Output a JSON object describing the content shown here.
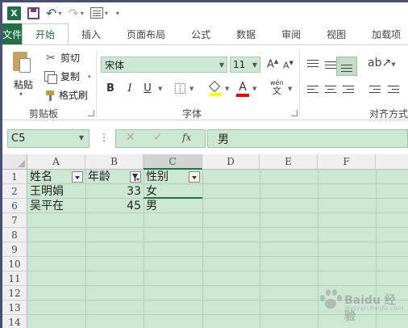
{
  "qat": {
    "app_icon": "X",
    "save": "save-icon",
    "undo": "undo-icon",
    "redo": "redo-icon",
    "form": "form-icon"
  },
  "tabs": [
    "文件",
    "开始",
    "插入",
    "页面布局",
    "公式",
    "数据",
    "审阅",
    "视图",
    "加载项"
  ],
  "active_tab": "开始",
  "ribbon": {
    "clipboard": {
      "paste": "粘贴",
      "cut": "剪切",
      "copy": "复制",
      "format_painter": "格式刷",
      "label": "剪贴板"
    },
    "font": {
      "name": "宋体",
      "size": "11",
      "grow": "A",
      "shrink": "A",
      "bold": "B",
      "italic": "I",
      "underline": "U",
      "font_color_letter": "A",
      "phonetic_top": "wén",
      "phonetic_bottom": "文",
      "label": "字体",
      "fill_color": "#ffff00",
      "font_color": "#ff0000"
    },
    "alignment": {
      "label": "对齐方式"
    }
  },
  "formula_bar": {
    "name_box": "C5",
    "cancel": "✕",
    "enter": "✓",
    "fx": "fx",
    "value": "男"
  },
  "columns": [
    "A",
    "B",
    "C",
    "D",
    "E",
    "F"
  ],
  "rows": [
    {
      "num": "1",
      "cells": [
        "姓名",
        "年龄",
        "性别"
      ]
    },
    {
      "num": "2",
      "cells": [
        "王明娟",
        "33",
        "女"
      ]
    },
    {
      "num": "6",
      "cells": [
        "吴平在",
        "45",
        "男"
      ]
    },
    {
      "num": "7",
      "cells": [
        "",
        "",
        ""
      ]
    },
    {
      "num": "8",
      "cells": [
        "",
        "",
        ""
      ]
    },
    {
      "num": "9",
      "cells": [
        "",
        "",
        ""
      ]
    },
    {
      "num": "10",
      "cells": [
        "",
        "",
        ""
      ]
    },
    {
      "num": "11",
      "cells": [
        "",
        "",
        ""
      ]
    },
    {
      "num": "12",
      "cells": [
        "",
        "",
        ""
      ]
    },
    {
      "num": "13",
      "cells": [
        "",
        "",
        ""
      ]
    },
    {
      "num": "14",
      "cells": [
        "",
        "",
        ""
      ]
    }
  ],
  "watermark": {
    "text": "Baidu 经验",
    "sub": "jingyan.baidu.com"
  },
  "colors": {
    "excel_green": "#217346",
    "sheet_tint": "#cde8d2",
    "filtered_row_number": "#2457b5"
  }
}
